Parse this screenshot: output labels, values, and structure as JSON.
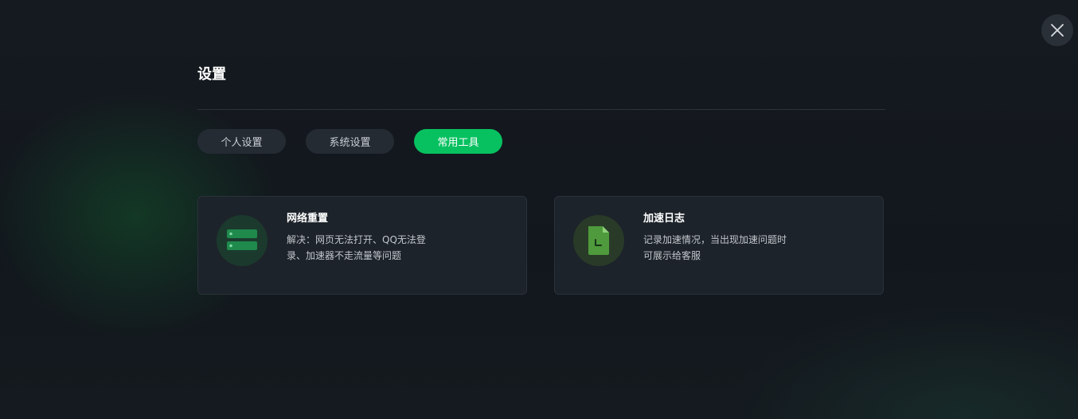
{
  "window": {
    "close_icon": "close-icon"
  },
  "header": {
    "title": "设置"
  },
  "tabs": [
    {
      "label": "个人设置",
      "active": false
    },
    {
      "label": "系统设置",
      "active": false
    },
    {
      "label": "常用工具",
      "active": true
    }
  ],
  "tools": [
    {
      "title": "网络重置",
      "description": "解决：网页无法打开、QQ无法登录、加速器不走流量等问题",
      "icon": "server-icon"
    },
    {
      "title": "加速日志",
      "description": "记录加速情况，当出现加速问题时可展示给客服",
      "icon": "log-file-icon"
    }
  ],
  "colors": {
    "accent": "#07c160",
    "card_bg": "#1d232a",
    "tab_bg": "#242b33"
  }
}
